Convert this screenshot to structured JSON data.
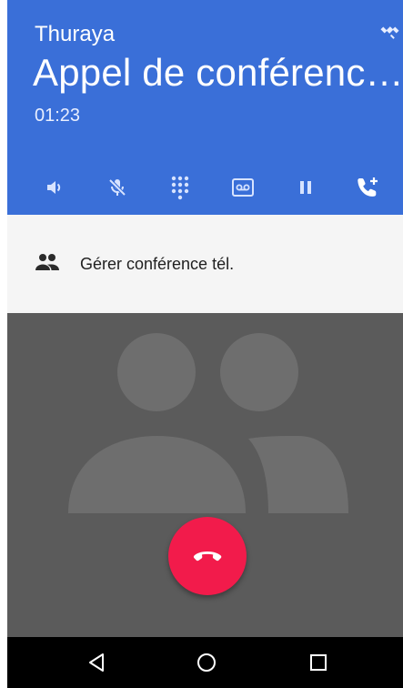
{
  "header": {
    "carrier": "Thuraya",
    "title": "Appel de conférenc…",
    "timer": "01:23",
    "background_color": "#3a6fd8"
  },
  "controls": [
    {
      "name": "speaker",
      "icon": "speaker-icon"
    },
    {
      "name": "mute",
      "icon": "mic-off-icon"
    },
    {
      "name": "dialpad",
      "icon": "dialpad-icon"
    },
    {
      "name": "voicemail",
      "icon": "voicemail-icon"
    },
    {
      "name": "hold",
      "icon": "pause-icon"
    },
    {
      "name": "add-call",
      "icon": "add-call-icon"
    }
  ],
  "manage_conference": {
    "label": "Gérer conférence tél.",
    "icon": "people-icon"
  },
  "end_call": {
    "icon": "end-call-icon",
    "color": "#f21b4b"
  },
  "navbar": {
    "items": [
      "back-icon",
      "home-icon",
      "recents-icon"
    ]
  }
}
